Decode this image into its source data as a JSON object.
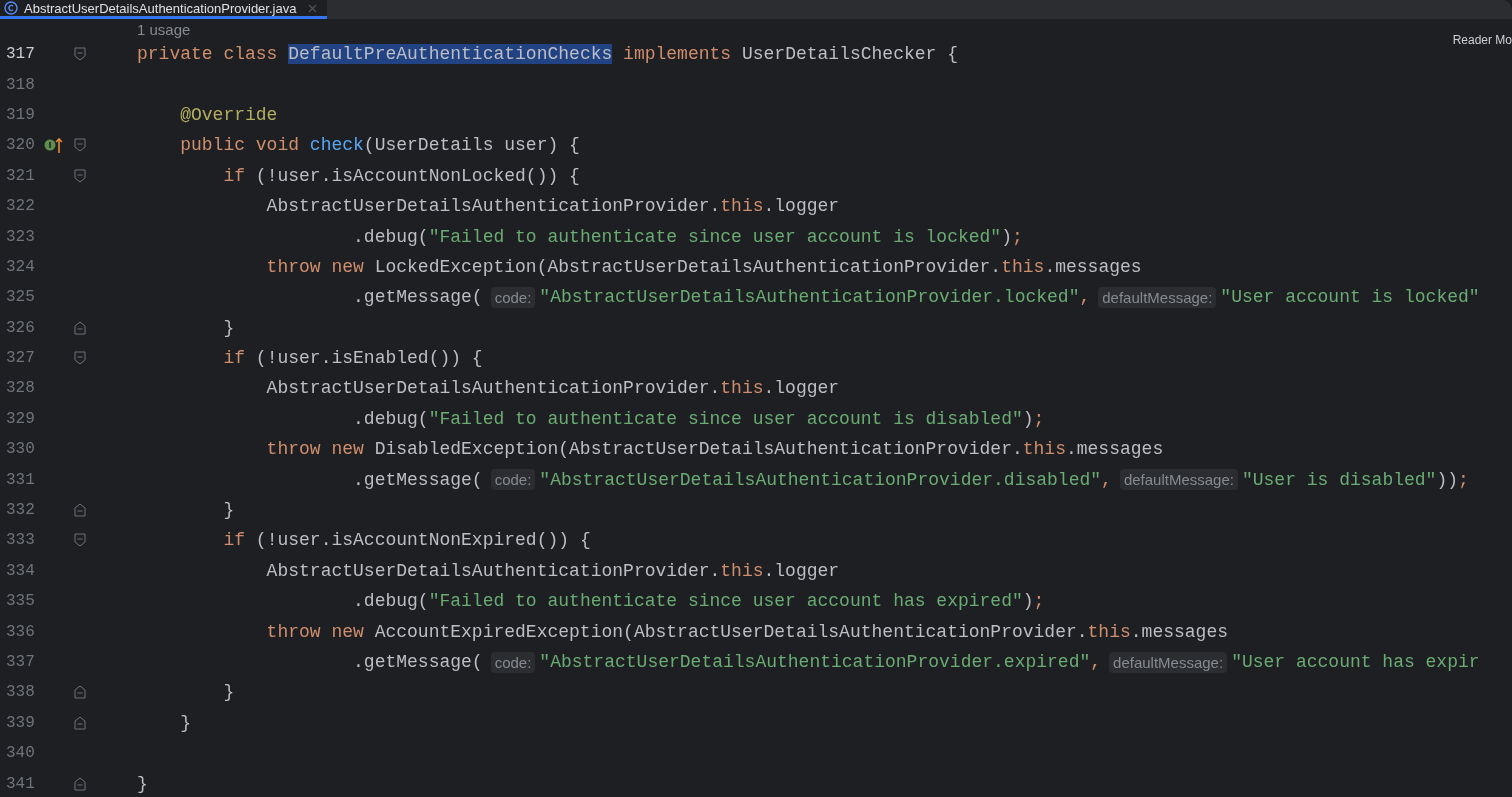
{
  "tab": {
    "title": "AbstractUserDetailsAuthenticationProvider.java",
    "selected": true
  },
  "usage_hint": "1 usage",
  "reader_mode": "Reader Mo",
  "lines": [
    {
      "number": "317",
      "current": true,
      "fold_start": true,
      "tokens": [
        {
          "kind": "keyword",
          "t": "private class "
        },
        {
          "kind": "highlight",
          "t": "DefaultPreAuthenticationChecks"
        },
        {
          "kind": "keyword",
          "t": " implements "
        },
        {
          "kind": "plain",
          "t": "UserDetailsChecker {"
        }
      ]
    },
    {
      "number": "318",
      "current": false
    },
    {
      "number": "319",
      "current": false,
      "tokens": [
        {
          "kind": "annotation",
          "t": "    @Override"
        }
      ]
    },
    {
      "number": "320",
      "current": false,
      "fold_start": true,
      "implements": true,
      "tokens": [
        {
          "kind": "keyword",
          "t": "    public void "
        },
        {
          "kind": "method",
          "t": "check"
        },
        {
          "kind": "plain",
          "t": "(UserDetails user) {"
        }
      ]
    },
    {
      "number": "321",
      "current": false,
      "fold_start": true,
      "tokens": [
        {
          "kind": "keyword",
          "t": "        if "
        },
        {
          "kind": "plain",
          "t": "(!user.isAccountNonLocked()) {"
        }
      ]
    },
    {
      "number": "322",
      "current": false,
      "tokens": [
        {
          "kind": "plain",
          "t": "            AbstractUserDetailsAuthenticationProvider."
        },
        {
          "kind": "keyword",
          "t": "this"
        },
        {
          "kind": "plain",
          "t": ".logger"
        }
      ]
    },
    {
      "number": "323",
      "current": false,
      "tokens": [
        {
          "kind": "plain",
          "t": "                    .debug("
        },
        {
          "kind": "string",
          "t": "\"Failed to authenticate since user account is locked\""
        },
        {
          "kind": "plain",
          "t": ")"
        },
        {
          "kind": "keyword",
          "t": ";"
        }
      ]
    },
    {
      "number": "324",
      "current": false,
      "tokens": [
        {
          "kind": "keyword",
          "t": "            throw new "
        },
        {
          "kind": "plain",
          "t": "LockedException(AbstractUserDetailsAuthenticationProvider."
        },
        {
          "kind": "keyword",
          "t": "this"
        },
        {
          "kind": "plain",
          "t": ".messages"
        }
      ]
    },
    {
      "number": "325",
      "current": false,
      "tokens": [
        {
          "kind": "plain",
          "t": "                    .getMessage("
        },
        {
          "kind": "hint",
          "t": "code:"
        },
        {
          "kind": "string",
          "t": "\"AbstractUserDetailsAuthenticationProvider.locked\""
        },
        {
          "kind": "keyword",
          "t": ","
        },
        {
          "kind": "hint",
          "t": "defaultMessage:"
        },
        {
          "kind": "string",
          "t": "\"User account is locked\""
        }
      ]
    },
    {
      "number": "326",
      "current": false,
      "fold_end": true,
      "tokens": [
        {
          "kind": "plain",
          "t": "        }"
        }
      ]
    },
    {
      "number": "327",
      "current": false,
      "fold_start": true,
      "tokens": [
        {
          "kind": "keyword",
          "t": "        if "
        },
        {
          "kind": "plain",
          "t": "(!user.isEnabled()) {"
        }
      ]
    },
    {
      "number": "328",
      "current": false,
      "tokens": [
        {
          "kind": "plain",
          "t": "            AbstractUserDetailsAuthenticationProvider."
        },
        {
          "kind": "keyword",
          "t": "this"
        },
        {
          "kind": "plain",
          "t": ".logger"
        }
      ]
    },
    {
      "number": "329",
      "current": false,
      "tokens": [
        {
          "kind": "plain",
          "t": "                    .debug("
        },
        {
          "kind": "string",
          "t": "\"Failed to authenticate since user account is disabled\""
        },
        {
          "kind": "plain",
          "t": ")"
        },
        {
          "kind": "keyword",
          "t": ";"
        }
      ]
    },
    {
      "number": "330",
      "current": false,
      "tokens": [
        {
          "kind": "keyword",
          "t": "            throw new "
        },
        {
          "kind": "plain",
          "t": "DisabledException(AbstractUserDetailsAuthenticationProvider."
        },
        {
          "kind": "keyword",
          "t": "this"
        },
        {
          "kind": "plain",
          "t": ".messages"
        }
      ]
    },
    {
      "number": "331",
      "current": false,
      "tokens": [
        {
          "kind": "plain",
          "t": "                    .getMessage("
        },
        {
          "kind": "hint",
          "t": "code:"
        },
        {
          "kind": "string",
          "t": "\"AbstractUserDetailsAuthenticationProvider.disabled\""
        },
        {
          "kind": "keyword",
          "t": ","
        },
        {
          "kind": "hint",
          "t": "defaultMessage:"
        },
        {
          "kind": "string",
          "t": "\"User is disabled\""
        },
        {
          "kind": "plain",
          "t": "))"
        },
        {
          "kind": "keyword",
          "t": ";"
        }
      ]
    },
    {
      "number": "332",
      "current": false,
      "fold_end": true,
      "tokens": [
        {
          "kind": "plain",
          "t": "        }"
        }
      ]
    },
    {
      "number": "333",
      "current": false,
      "fold_start": true,
      "tokens": [
        {
          "kind": "keyword",
          "t": "        if "
        },
        {
          "kind": "plain",
          "t": "(!user.isAccountNonExpired()) {"
        }
      ]
    },
    {
      "number": "334",
      "current": false,
      "tokens": [
        {
          "kind": "plain",
          "t": "            AbstractUserDetailsAuthenticationProvider."
        },
        {
          "kind": "keyword",
          "t": "this"
        },
        {
          "kind": "plain",
          "t": ".logger"
        }
      ]
    },
    {
      "number": "335",
      "current": false,
      "tokens": [
        {
          "kind": "plain",
          "t": "                    .debug("
        },
        {
          "kind": "string",
          "t": "\"Failed to authenticate since user account has expired\""
        },
        {
          "kind": "plain",
          "t": ")"
        },
        {
          "kind": "keyword",
          "t": ";"
        }
      ]
    },
    {
      "number": "336",
      "current": false,
      "tokens": [
        {
          "kind": "keyword",
          "t": "            throw new "
        },
        {
          "kind": "plain",
          "t": "AccountExpiredException(AbstractUserDetailsAuthenticationProvider."
        },
        {
          "kind": "keyword",
          "t": "this"
        },
        {
          "kind": "plain",
          "t": ".messages"
        }
      ]
    },
    {
      "number": "337",
      "current": false,
      "tokens": [
        {
          "kind": "plain",
          "t": "                    .getMessage("
        },
        {
          "kind": "hint",
          "t": "code:"
        },
        {
          "kind": "string",
          "t": "\"AbstractUserDetailsAuthenticationProvider.expired\""
        },
        {
          "kind": "keyword",
          "t": ","
        },
        {
          "kind": "hint",
          "t": "defaultMessage:"
        },
        {
          "kind": "string",
          "t": "\"User account has expir"
        }
      ]
    },
    {
      "number": "338",
      "current": false,
      "fold_end": true,
      "tokens": [
        {
          "kind": "plain",
          "t": "        }"
        }
      ]
    },
    {
      "number": "339",
      "current": false,
      "fold_end": true,
      "tokens": [
        {
          "kind": "plain",
          "t": "    }"
        }
      ]
    },
    {
      "number": "340",
      "current": false
    },
    {
      "number": "341",
      "current": false,
      "fold_end": true,
      "tokens": [
        {
          "kind": "plain",
          "t": "}"
        }
      ]
    }
  ]
}
